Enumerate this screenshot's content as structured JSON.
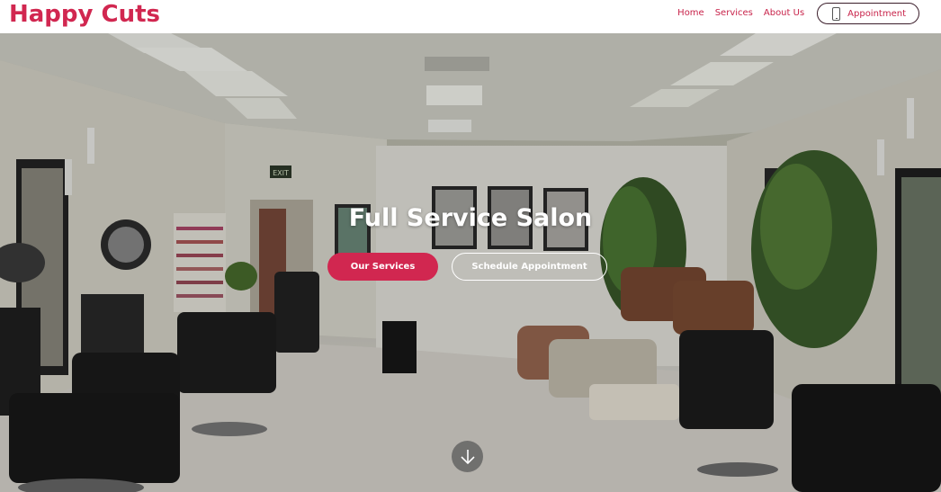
{
  "header": {
    "logo": "Happy Cuts",
    "nav": [
      {
        "label": "Home"
      },
      {
        "label": "Services"
      },
      {
        "label": "About Us"
      }
    ],
    "appointment_label": "Appointment"
  },
  "hero": {
    "title": "Full Service Salon",
    "primary_button": "Our Services",
    "secondary_button": "Schedule Appointment",
    "exit_sign": "EXIT"
  },
  "colors": {
    "brand": "#d12750",
    "button_text": "#ffffff"
  }
}
